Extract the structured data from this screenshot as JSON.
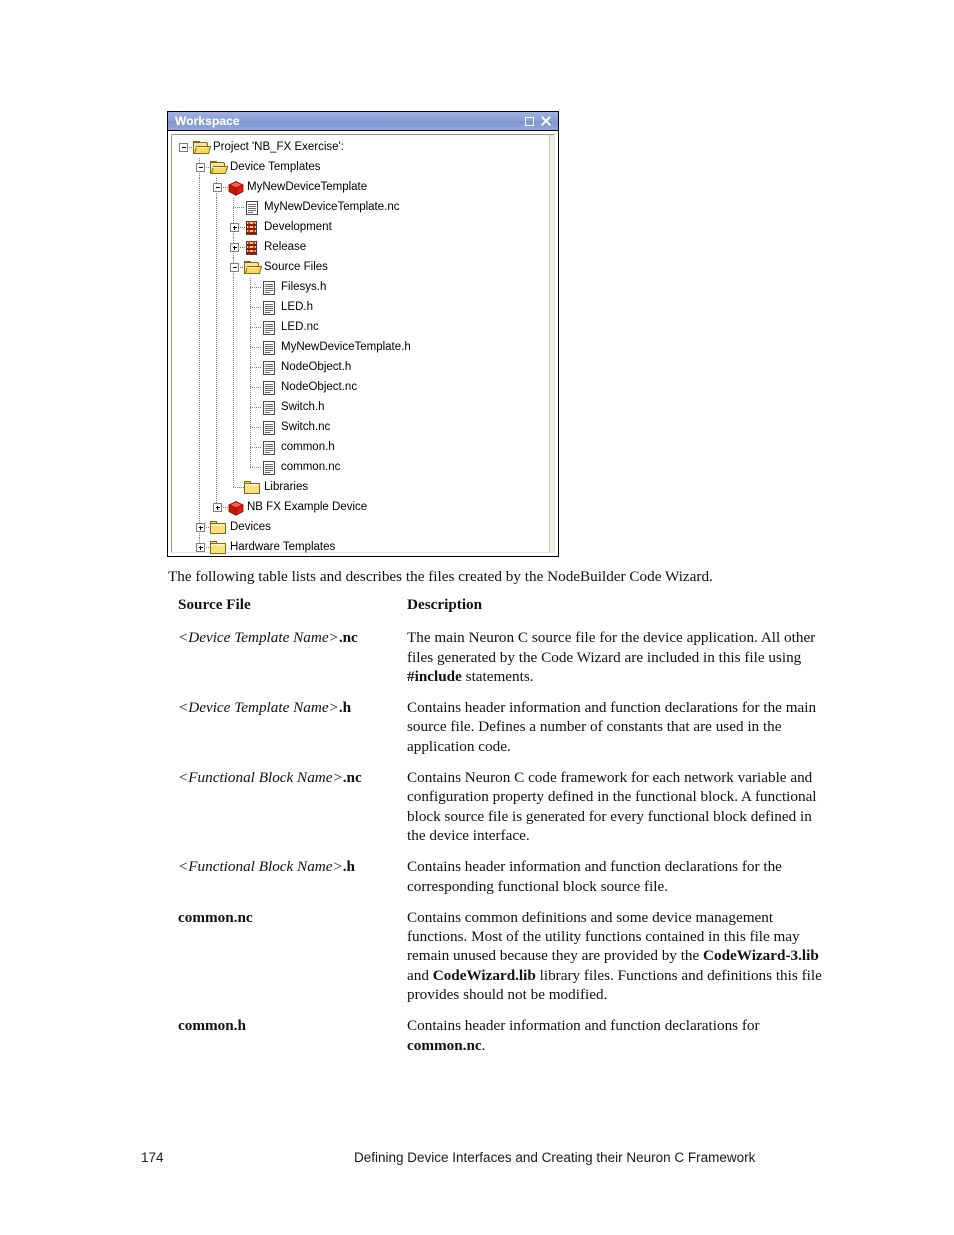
{
  "workspace_panel": {
    "title": "Workspace",
    "titlebar_color": "#8b9fd6",
    "buttons": {
      "restore": "restore",
      "close": "close"
    },
    "tree": [
      {
        "depth": 0,
        "expander": "minus",
        "icon": "folder-open-icon",
        "label": "Project 'NB_FX Exercise':"
      },
      {
        "depth": 1,
        "expander": "minus",
        "icon": "folder-open-icon",
        "label": "Device Templates"
      },
      {
        "depth": 2,
        "expander": "minus",
        "icon": "device-template-icon",
        "label": "MyNewDeviceTemplate"
      },
      {
        "depth": 3,
        "expander": "none",
        "icon": "source-file-icon",
        "label": "MyNewDeviceTemplate.nc"
      },
      {
        "depth": 3,
        "expander": "plus",
        "icon": "build-config-icon",
        "label": "Development"
      },
      {
        "depth": 3,
        "expander": "plus",
        "icon": "build-config-icon",
        "label": "Release"
      },
      {
        "depth": 3,
        "expander": "minus",
        "icon": "folder-open-icon",
        "label": "Source Files"
      },
      {
        "depth": 4,
        "expander": "none",
        "icon": "source-file-icon",
        "label": "Filesys.h"
      },
      {
        "depth": 4,
        "expander": "none",
        "icon": "source-file-icon",
        "label": "LED.h"
      },
      {
        "depth": 4,
        "expander": "none",
        "icon": "source-file-icon",
        "label": "LED.nc"
      },
      {
        "depth": 4,
        "expander": "none",
        "icon": "source-file-icon",
        "label": "MyNewDeviceTemplate.h"
      },
      {
        "depth": 4,
        "expander": "none",
        "icon": "source-file-icon",
        "label": "NodeObject.h"
      },
      {
        "depth": 4,
        "expander": "none",
        "icon": "source-file-icon",
        "label": "NodeObject.nc"
      },
      {
        "depth": 4,
        "expander": "none",
        "icon": "source-file-icon",
        "label": "Switch.h"
      },
      {
        "depth": 4,
        "expander": "none",
        "icon": "source-file-icon",
        "label": "Switch.nc"
      },
      {
        "depth": 4,
        "expander": "none",
        "icon": "source-file-icon",
        "label": "common.h"
      },
      {
        "depth": 4,
        "expander": "none",
        "icon": "source-file-icon",
        "label": "common.nc"
      },
      {
        "depth": 3,
        "expander": "none",
        "icon": "folder-icon",
        "label": "Libraries"
      },
      {
        "depth": 2,
        "expander": "plus",
        "icon": "device-template-icon",
        "label": "NB FX Example Device"
      },
      {
        "depth": 1,
        "expander": "plus",
        "icon": "folder-icon",
        "label": "Devices"
      },
      {
        "depth": 1,
        "expander": "plus",
        "icon": "folder-icon",
        "label": "Hardware Templates"
      }
    ]
  },
  "document": {
    "intro": "The following table lists and describes the files created by the NodeBuilder Code Wizard.",
    "table": {
      "headers": {
        "source_file": "Source File",
        "description": "Description"
      },
      "rows": [
        {
          "name_italic": "<Device Template Name>",
          "name_bold": ".nc",
          "desc_part1": "The main Neuron C source file for the device application.  All other files generated by the Code Wizard are included in this file using ",
          "desc_bold1": "#include",
          "desc_part2": " statements.",
          "desc_bold2": "",
          "desc_part3": ""
        },
        {
          "name_italic": "<Device Template Name>",
          "name_bold": ".h",
          "desc_part1": "Contains header information and function declarations for the main source file.  Defines a number of constants that are used in the application code.",
          "desc_bold1": "",
          "desc_part2": "",
          "desc_bold2": "",
          "desc_part3": ""
        },
        {
          "name_italic": "<Functional Block Name>",
          "name_bold": ".nc",
          "desc_part1": "Contains Neuron C code framework for each network variable and configuration property defined in the functional block.  A functional block source file is generated for every functional block defined in the device interface.",
          "desc_bold1": "",
          "desc_part2": "",
          "desc_bold2": "",
          "desc_part3": ""
        },
        {
          "name_italic": "<Functional Block Name>",
          "name_bold": ".h",
          "desc_part1": "Contains header information and function declarations for the corresponding functional block source file.",
          "desc_bold1": "",
          "desc_part2": "",
          "desc_bold2": "",
          "desc_part3": ""
        },
        {
          "name_italic": "",
          "name_bold": "common.nc",
          "desc_part1": "Contains common definitions and some device management functions.  Most of the utility functions contained in this file may remain unused because they are provided by the ",
          "desc_bold1": "CodeWizard-3.lib",
          "desc_part2": " and ",
          "desc_bold2": "CodeWizard.lib",
          "desc_part3": " library files.   Functions and definitions this file provides should not be modified."
        },
        {
          "name_italic": "",
          "name_bold": "common.h",
          "desc_part1": "Contains header information and function declarations for ",
          "desc_bold1": "common.nc",
          "desc_part2": ".",
          "desc_bold2": "",
          "desc_part3": ""
        }
      ]
    }
  },
  "footer": {
    "page_number": "174",
    "title": "Defining Device Interfaces and Creating their Neuron C Framework"
  }
}
